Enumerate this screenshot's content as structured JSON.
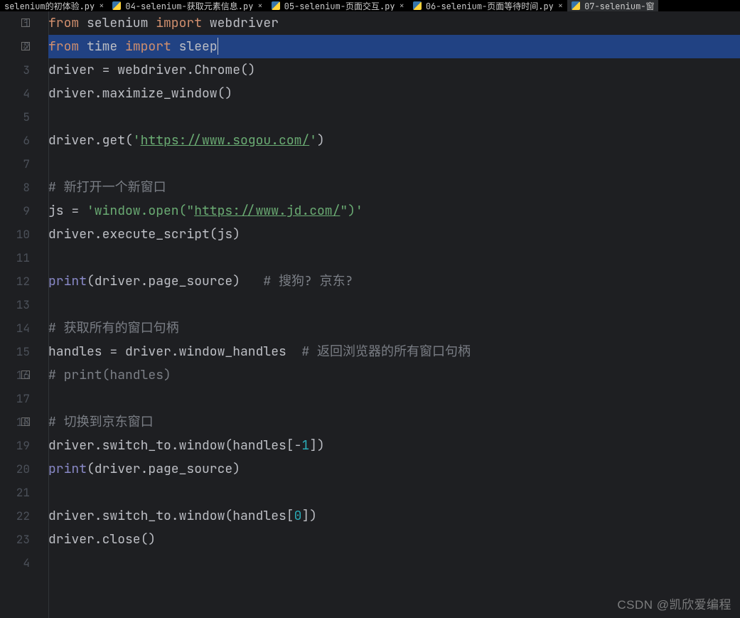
{
  "tabs": [
    {
      "label": "selenium的初体验.py",
      "active": false
    },
    {
      "label": "04-selenium-获取元素信息.py",
      "active": false
    },
    {
      "label": "05-selenium-页面交互.py",
      "active": false
    },
    {
      "label": "06-selenium-页面等待时间.py",
      "active": false
    },
    {
      "label": "07-selenium-窗",
      "active": true
    }
  ],
  "lines": {
    "l1_kw1": "from",
    "l1_id1": " selenium ",
    "l1_kw2": "import",
    "l1_id2": " webdriver",
    "l2_kw1": "from",
    "l2_id1": " time ",
    "l2_kw2": "import",
    "l2_id2": " sleep",
    "l3_txt": "driver = webdriver.Chrome()",
    "l4_txt": "driver.maximize_window()",
    "l5_txt": "",
    "l6_a": "driver.get(",
    "l6_s1": "'",
    "l6_link": "https://www.sogou.com/",
    "l6_s2": "'",
    "l6_b": ")",
    "l7_txt": "",
    "l8_cmt": "# 新打开一个新窗口",
    "l9_a": "js = ",
    "l9_s1": "'window.open(\"",
    "l9_link": "https://www.jd.com/",
    "l9_s2": "\")'",
    "l10_txt": "driver.execute_script(js)",
    "l11_txt": "",
    "l12_fn": "print",
    "l12_p": "(driver.page_source)   ",
    "l12_cmt": "# 搜狗? 京东?",
    "l13_txt": "",
    "l14_cmt": "# 获取所有的窗口句柄",
    "l15_a": "handles = driver.window_handles  ",
    "l15_cmt": "# 返回浏览器的所有窗口句柄",
    "l16_cmt": "# print(handles)",
    "l17_txt": "",
    "l18_cmt": "# 切换到京东窗口",
    "l19_a": "driver.switch_to.window(handles[-",
    "l19_n": "1",
    "l19_b": "])",
    "l20_fn": "print",
    "l20_p": "(driver.page_source)",
    "l21_txt": "",
    "l22_a": "driver.switch_to.window(handles[",
    "l22_n": "0",
    "l22_b": "])",
    "l23_txt": "driver.close()",
    "l24_txt": ""
  },
  "watermark": "CSDN @凯欣爱编程",
  "last_visible_line_digit": "4"
}
